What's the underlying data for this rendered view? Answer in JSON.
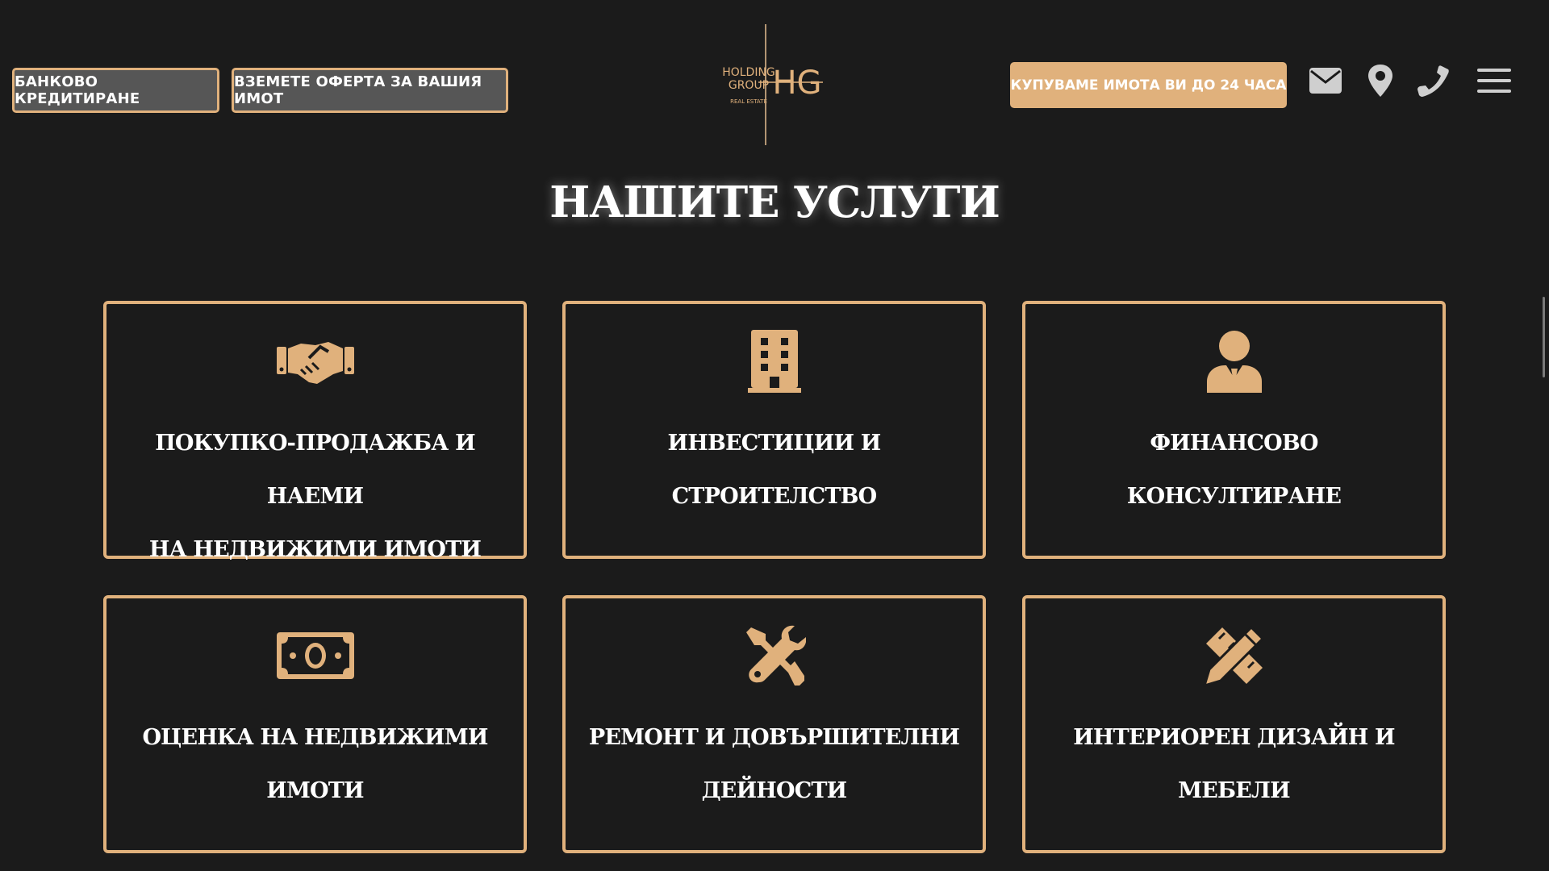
{
  "header": {
    "credit_button": "БАНКОВО КРЕДИТИРАНЕ",
    "offer_button": "ВЗЕМЕТЕ ОФЕРТА ЗА ВАШИЯ ИМОТ",
    "buy_button": "КУПУВАМЕ ИМОТА ВИ ДО 24 ЧАСА",
    "logo": {
      "line1": "HOLDING",
      "line2": "GROUP",
      "line3": "REAL ESTATE",
      "monogram": "HG"
    },
    "icons": [
      "envelope-icon",
      "map-pin-icon",
      "phone-icon",
      "hamburger-menu-icon"
    ]
  },
  "section": {
    "title": "НАШИТЕ УСЛУГИ"
  },
  "services": [
    {
      "line1": "ПОКУПКО-ПРОДАЖБА И НАЕМИ",
      "line2": "НА НЕДВИЖИМИ ИМОТИ",
      "icon": "handshake-icon"
    },
    {
      "line1": "ИНВЕСТИЦИИ И",
      "line2": "СТРОИТЕЛСТВО",
      "icon": "building-icon"
    },
    {
      "line1": "ФИНАНСОВО",
      "line2": "КОНСУЛТИРАНЕ",
      "icon": "user-tie-icon"
    },
    {
      "line1": "ОЦЕНКА НА НЕДВИЖИМИ",
      "line2": "ИМОТИ",
      "icon": "money-bill-icon"
    },
    {
      "line1": "РЕМОНТ И ДОВЪРШИТЕЛНИ",
      "line2": "ДЕЙНОСТИ",
      "icon": "tools-icon"
    },
    {
      "line1": "ИНТЕРИОРЕН ДИЗАЙН И",
      "line2": "МЕБЕЛИ",
      "icon": "pencil-ruler-icon"
    }
  ],
  "colors": {
    "background": "#1b1b1b",
    "accent": "#e0b17c",
    "button_gray": "#565656",
    "text": "#ffffff",
    "icon_gray": "#cfcfcf"
  }
}
